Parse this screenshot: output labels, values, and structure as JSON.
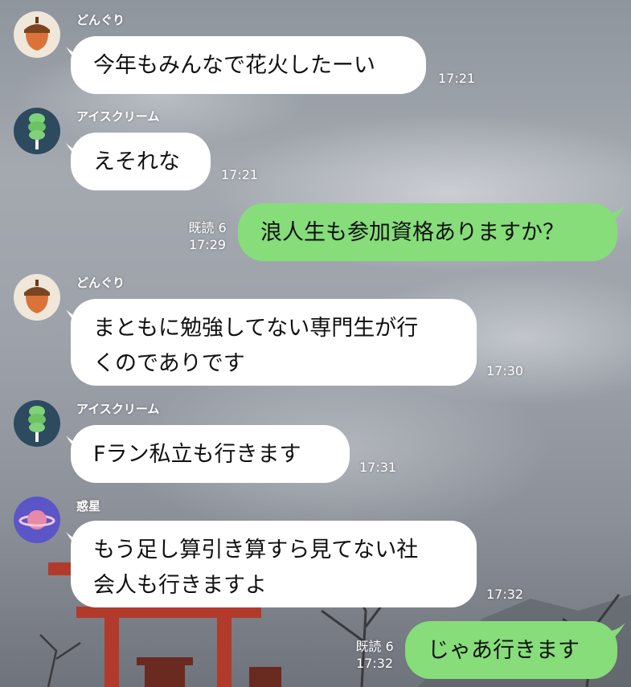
{
  "chat": {
    "messages": [
      {
        "sender": "どんぐり",
        "avatar_icon": "acorn-icon",
        "text": "今年もみんなで花火したーい",
        "time": "17:21"
      },
      {
        "sender": "アイスクリーム",
        "avatar_icon": "ice-cream-icon",
        "text": "えそれな",
        "time": "17:21"
      },
      {
        "sender": "me",
        "text": "浪人生も参加資格ありますか？",
        "read": "既読 6",
        "time": "17:29"
      },
      {
        "sender": "どんぐり",
        "avatar_icon": "acorn-icon",
        "text_line1": "まともに勉強してない専門生が行",
        "text_line2": "くのでありです",
        "time": "17:30"
      },
      {
        "sender": "アイスクリーム",
        "avatar_icon": "ice-cream-icon",
        "text": "Fラン私立も行きます",
        "time": "17:31"
      },
      {
        "sender": "惑星",
        "avatar_icon": "planet-icon",
        "text_line1": "もう足し算引き算すら見てない社",
        "text_line2": "会人も行きますよ",
        "time": "17:32"
      },
      {
        "sender": "me",
        "text": "じゃあ行きます",
        "read": "既読 6",
        "time": "17:32"
      }
    ]
  },
  "colors": {
    "outgoing_bubble": "#86dd7a",
    "incoming_bubble": "#ffffff"
  }
}
